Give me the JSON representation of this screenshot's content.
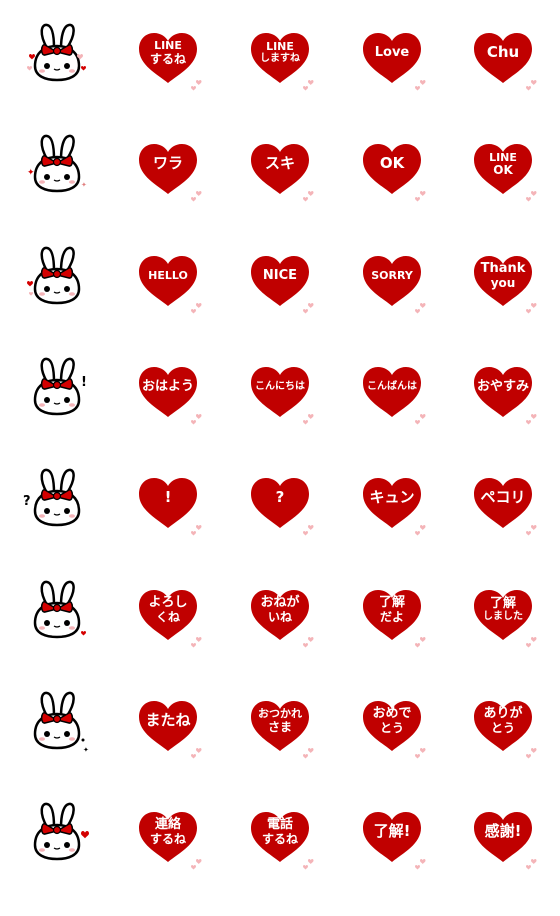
{
  "colors": {
    "heart": "#c00000",
    "pink": "#f4b4b8",
    "ribbon": "#d40000",
    "outline": "#000000"
  },
  "rows": [
    {
      "rabbit_accent": "hearts",
      "stickers": [
        {
          "line1": "LINE",
          "line2": "するね"
        },
        {
          "line1": "LINE",
          "line2": "しますね"
        },
        {
          "line1": "Love"
        },
        {
          "line1": "Chu"
        }
      ]
    },
    {
      "rabbit_accent": "sparkles",
      "stickers": [
        {
          "line1": "ワラ"
        },
        {
          "line1": "スキ"
        },
        {
          "line1": "OK"
        },
        {
          "line1": "LINE",
          "line2": "OK"
        }
      ]
    },
    {
      "rabbit_accent": "heart",
      "stickers": [
        {
          "line1": "HELLO"
        },
        {
          "line1": "NICE"
        },
        {
          "line1": "SORRY"
        },
        {
          "line1": "Thank",
          "line2": "you"
        }
      ]
    },
    {
      "rabbit_accent": "exclamation",
      "stickers": [
        {
          "line1": "おはよう"
        },
        {
          "line1": "こんにちは"
        },
        {
          "line1": "こんばんは"
        },
        {
          "line1": "おやすみ"
        }
      ]
    },
    {
      "rabbit_accent": "question",
      "stickers": [
        {
          "line1": "!"
        },
        {
          "line1": "?"
        },
        {
          "line1": "キュン"
        },
        {
          "line1": "ペコリ"
        }
      ]
    },
    {
      "rabbit_accent": "heart-small",
      "stickers": [
        {
          "line1": "よろし",
          "line2": "くね"
        },
        {
          "line1": "おねが",
          "line2": "いね"
        },
        {
          "line1": "了解",
          "line2": "だよ"
        },
        {
          "line1": "了解",
          "line2": "しました"
        }
      ]
    },
    {
      "rabbit_accent": "dots",
      "stickers": [
        {
          "line1": "またね"
        },
        {
          "line1": "おつかれ",
          "line2": "さま"
        },
        {
          "line1": "おめで",
          "line2": "とう"
        },
        {
          "line1": "ありが",
          "line2": "とう"
        }
      ]
    },
    {
      "rabbit_accent": "heart-red",
      "stickers": [
        {
          "line1": "連絡",
          "line2": "するね"
        },
        {
          "line1": "電話",
          "line2": "するね"
        },
        {
          "line1": "了解!"
        },
        {
          "line1": "感謝!"
        }
      ]
    }
  ]
}
